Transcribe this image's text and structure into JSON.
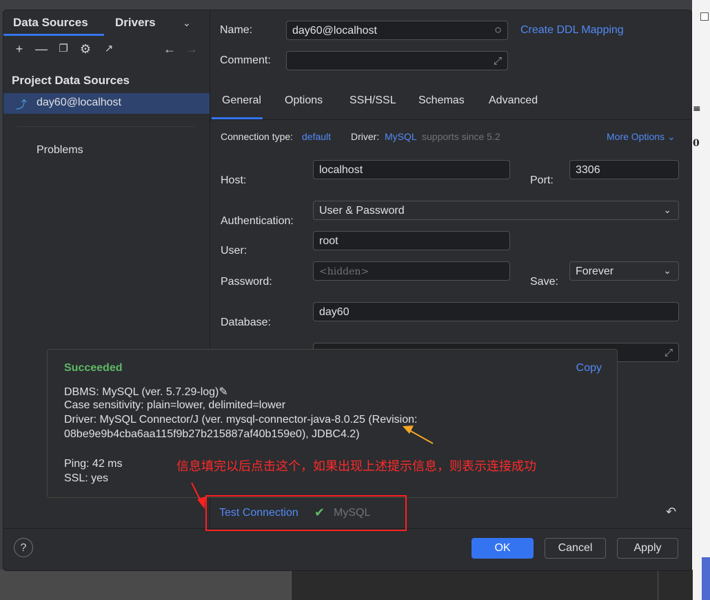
{
  "left_panel": {
    "tabs": [
      "Data Sources",
      "Drivers"
    ],
    "section_title": "Project Data Sources",
    "data_source": "day60@localhost",
    "problems": "Problems"
  },
  "form": {
    "name_label": "Name:",
    "name_value": "day60@localhost",
    "create_ddl": "Create DDL Mapping",
    "comment_label": "Comment:",
    "tabs": [
      "General",
      "Options",
      "SSH/SSL",
      "Schemas",
      "Advanced"
    ],
    "conn_type_label": "Connection type:",
    "conn_type_value": "default",
    "driver_label": "Driver:",
    "driver_value": "MySQL",
    "driver_note": "supports since 5.2",
    "more_options": "More Options",
    "host_label": "Host:",
    "host_value": "localhost",
    "port_label": "Port:",
    "port_value": "3306",
    "auth_label": "Authentication:",
    "auth_value": "User & Password",
    "user_label": "User:",
    "user_value": "root",
    "password_label": "Password:",
    "password_placeholder": "<hidden>",
    "save_label": "Save:",
    "save_value": "Forever",
    "database_label": "Database:",
    "database_value": "day60"
  },
  "popup": {
    "status": "Succeeded",
    "copy": "Copy",
    "dbms": "DBMS: MySQL (ver. 5.7.29-log)",
    "case": "Case sensitivity: plain=lower, delimited=lower",
    "driver1": "Driver: MySQL Connector/J (ver. mysql-connector-java-8.0.25 (Revision:",
    "driver2": "08be9e9b4cba6aa115f9b27b215887af40b159e0), JDBC4.2)",
    "ping": "Ping: 42 ms",
    "ssl": "SSL: yes"
  },
  "bottom": {
    "test_connection": "Test Connection",
    "driver_name": "MySQL",
    "help": "?",
    "ok": "OK",
    "cancel": "Cancel",
    "apply": "Apply"
  },
  "annotation": {
    "text": "信息填完以后点击这个，如果出现上述提示信息，则表示连接成功",
    "color": "#ff2a2a"
  },
  "colors": {
    "accent": "#3574f0",
    "success": "#5fb865",
    "link": "#548af7"
  }
}
